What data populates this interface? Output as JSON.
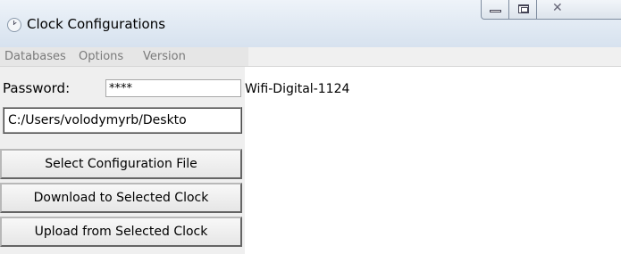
{
  "window": {
    "title": "Clock Configurations",
    "icon": "clock-icon",
    "controls": {
      "minimize": "minimize-icon",
      "maximize": "maximize-icon",
      "close": "close-icon",
      "close_glyph": "✕"
    }
  },
  "menu": {
    "items": [
      {
        "label": "Databases"
      },
      {
        "label": "Options"
      },
      {
        "label": "Version"
      }
    ]
  },
  "form": {
    "password_label": "Password:",
    "password_value": "****",
    "config_path": "C:/Users/volodymyrb/Deskto"
  },
  "buttons": {
    "select_config": "Select Configuration File",
    "download": "Download to Selected Clock",
    "upload": "Upload from Selected Clock"
  },
  "device": {
    "name": "Wifi-Digital-1124"
  }
}
